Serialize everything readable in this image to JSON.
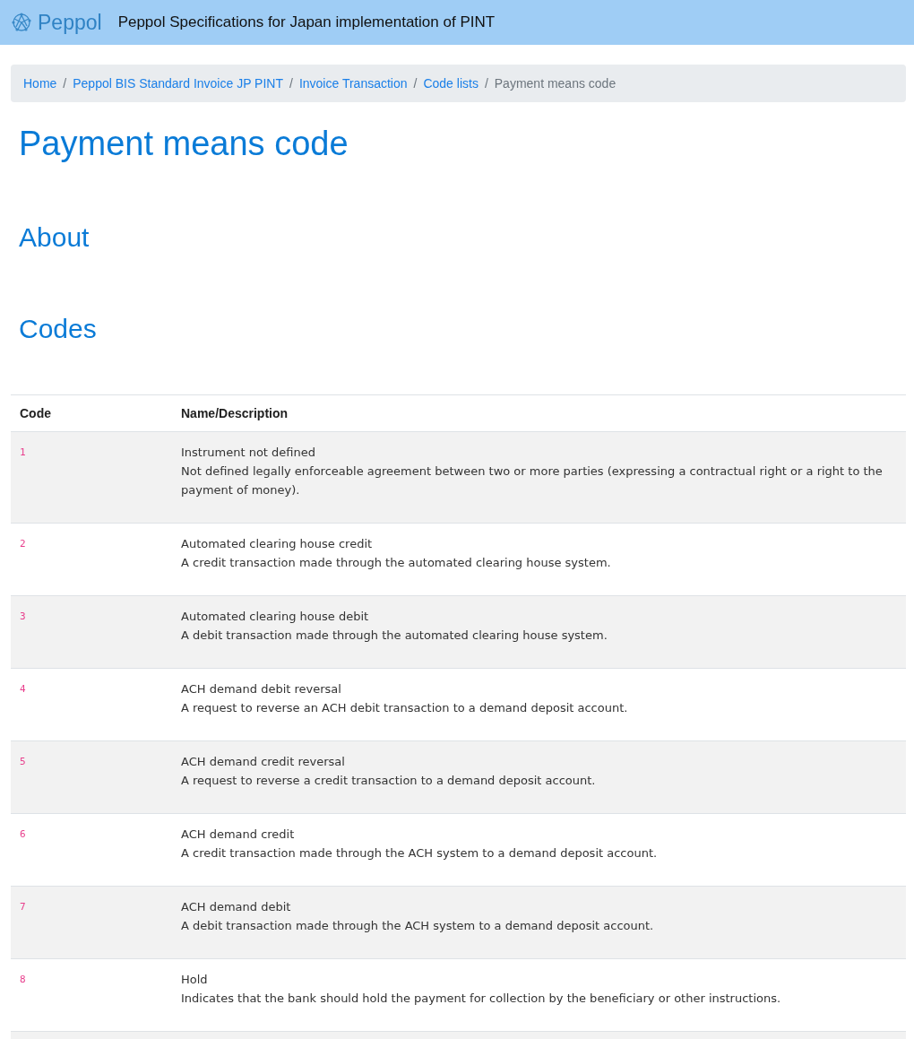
{
  "header": {
    "logo_text": "Peppol",
    "title": "Peppol Specifications for Japan implementation of PINT"
  },
  "breadcrumb": [
    {
      "label": "Home",
      "kind": "link"
    },
    {
      "separator": "/",
      "label": "Peppol BIS Standard Invoice JP PINT",
      "kind": "link"
    },
    {
      "separator": "/",
      "label": "Invoice Transaction",
      "kind": "link"
    },
    {
      "separator": "/",
      "label": "Code lists",
      "kind": "link"
    },
    {
      "separator": "/",
      "label": "Payment means code",
      "kind": "current"
    }
  ],
  "page_title": "Payment means code",
  "sections": [
    "About",
    "Codes"
  ],
  "table": {
    "columns": [
      "Code",
      "Name/Description"
    ],
    "rows": [
      {
        "code": "1",
        "name": "Instrument not defined",
        "description": "Not defined legally enforceable agreement between two or more parties (expressing a contractual right or a right to the payment of money)."
      },
      {
        "code": "2",
        "name": "Automated clearing house credit",
        "description": "A credit transaction made through the automated clearing house system."
      },
      {
        "code": "3",
        "name": "Automated clearing house debit",
        "description": "A debit transaction made through the automated clearing house system."
      },
      {
        "code": "4",
        "name": "ACH demand debit reversal",
        "description": "A request to reverse an ACH debit transaction to a demand deposit account."
      },
      {
        "code": "5",
        "name": "ACH demand credit reversal",
        "description": "A request to reverse a credit transaction to a demand deposit account."
      },
      {
        "code": "6",
        "name": "ACH demand credit",
        "description": "A credit transaction made through the ACH system to a demand deposit account."
      },
      {
        "code": "7",
        "name": "ACH demand debit",
        "description": "A debit transaction made through the ACH system to a demand deposit account."
      },
      {
        "code": "8",
        "name": "Hold",
        "description": "Indicates that the bank should hold the payment for collection by the beneficiary or other instructions."
      }
    ]
  }
}
